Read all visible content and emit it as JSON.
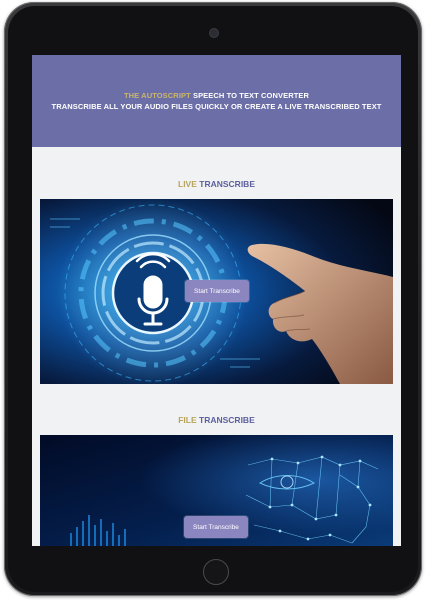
{
  "header": {
    "brand": "THE AUTOSCRIPT",
    "title_rest": " SPEECH TO TEXT CONVERTER",
    "subtitle": "TRANSCRIBE ALL YOUR AUDIO FILES QUICKLY OR CREATE A LIVE TRANSCRIBED TEXT"
  },
  "sections": [
    {
      "title_accent": "LIVE",
      "title_rest": " TRANSCRIBE",
      "button_label": "Start Transcribe",
      "image_icon": "microphone-icon"
    },
    {
      "title_accent": "FILE",
      "title_rest": " TRANSCRIBE",
      "button_label": "Start Transcribe",
      "image_icon": "face-mesh-icon"
    }
  ],
  "colors": {
    "banner": "#6c6fa7",
    "brand_accent": "#b8a55b",
    "title": "#5c5f9d",
    "button": "#8c86c0",
    "screen_bg": "#f1f2f4"
  }
}
